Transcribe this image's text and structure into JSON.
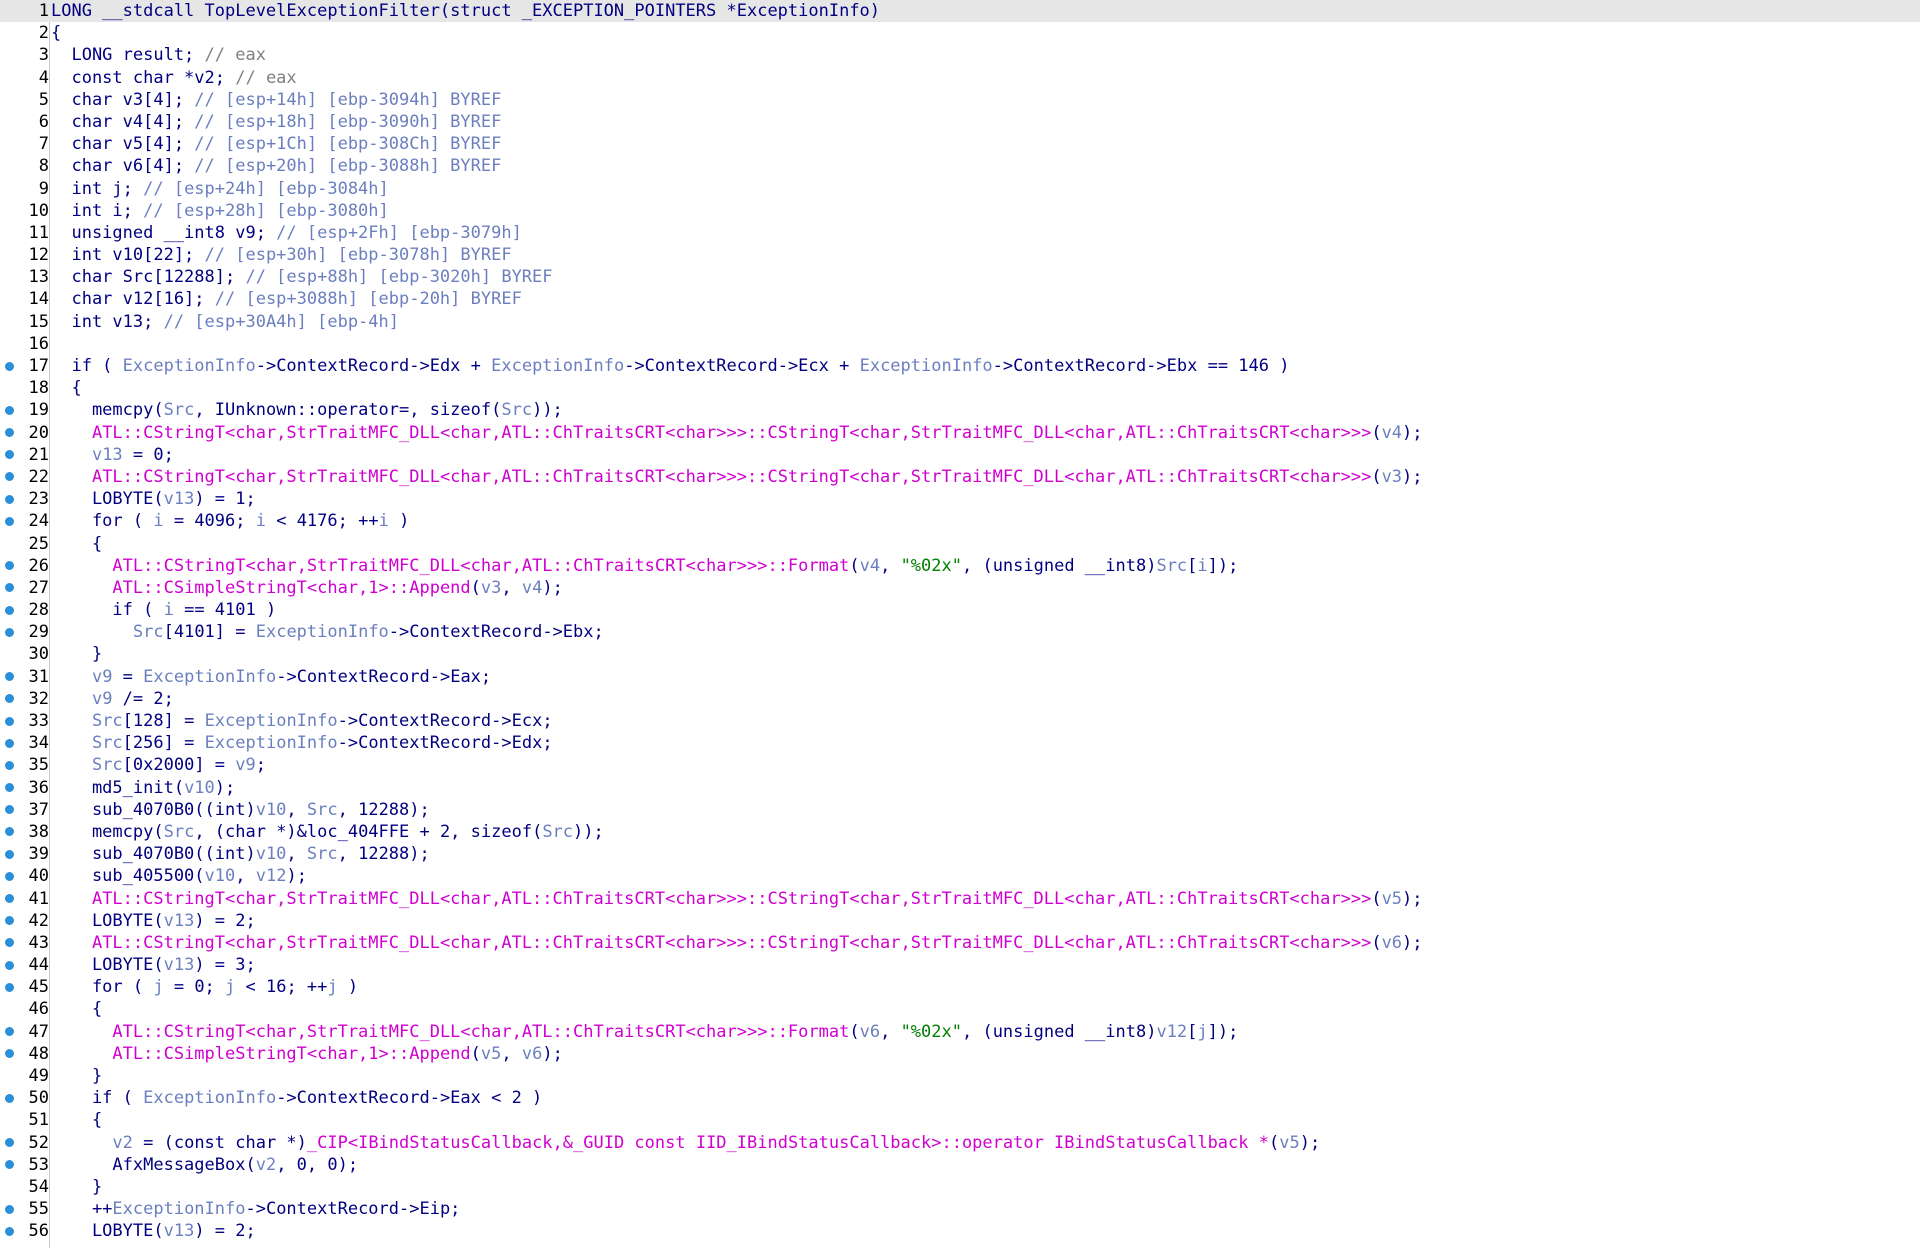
{
  "editor": {
    "lines": [
      {
        "n": "1",
        "dot": false,
        "hl": true,
        "t": [
          [
            "k",
            "LONG __stdcall TopLevelExceptionFilter(struct _EXCEPTION_POINTERS *ExceptionInfo)"
          ]
        ]
      },
      {
        "n": "2",
        "dot": false,
        "t": [
          [
            "k",
            "{"
          ]
        ]
      },
      {
        "n": "3",
        "dot": false,
        "t": [
          [
            "k",
            "  LONG result; "
          ],
          [
            "c",
            "// eax"
          ]
        ]
      },
      {
        "n": "4",
        "dot": false,
        "t": [
          [
            "k",
            "  const char *v2; "
          ],
          [
            "c",
            "// eax"
          ]
        ]
      },
      {
        "n": "5",
        "dot": false,
        "t": [
          [
            "k",
            "  char v3[4]; "
          ],
          [
            "v",
            "// [esp+14h] [ebp-3094h] BYREF"
          ]
        ]
      },
      {
        "n": "6",
        "dot": false,
        "t": [
          [
            "k",
            "  char v4[4]; "
          ],
          [
            "v",
            "// [esp+18h] [ebp-3090h] BYREF"
          ]
        ]
      },
      {
        "n": "7",
        "dot": false,
        "t": [
          [
            "k",
            "  char v5[4]; "
          ],
          [
            "v",
            "// [esp+1Ch] [ebp-308Ch] BYREF"
          ]
        ]
      },
      {
        "n": "8",
        "dot": false,
        "t": [
          [
            "k",
            "  char v6[4]; "
          ],
          [
            "v",
            "// [esp+20h] [ebp-3088h] BYREF"
          ]
        ]
      },
      {
        "n": "9",
        "dot": false,
        "t": [
          [
            "k",
            "  int j; "
          ],
          [
            "v",
            "// [esp+24h] [ebp-3084h]"
          ]
        ]
      },
      {
        "n": "10",
        "dot": false,
        "t": [
          [
            "k",
            "  int i; "
          ],
          [
            "v",
            "// [esp+28h] [ebp-3080h]"
          ]
        ]
      },
      {
        "n": "11",
        "dot": false,
        "t": [
          [
            "k",
            "  unsigned __int8 v9; "
          ],
          [
            "v",
            "// [esp+2Fh] [ebp-3079h]"
          ]
        ]
      },
      {
        "n": "12",
        "dot": false,
        "t": [
          [
            "k",
            "  int v10[22]; "
          ],
          [
            "v",
            "// [esp+30h] [ebp-3078h] BYREF"
          ]
        ]
      },
      {
        "n": "13",
        "dot": false,
        "t": [
          [
            "k",
            "  char Src[12288]; "
          ],
          [
            "v",
            "// [esp+88h] [ebp-3020h] BYREF"
          ]
        ]
      },
      {
        "n": "14",
        "dot": false,
        "t": [
          [
            "k",
            "  char v12[16]; "
          ],
          [
            "v",
            "// [esp+3088h] [ebp-20h] BYREF"
          ]
        ]
      },
      {
        "n": "15",
        "dot": false,
        "t": [
          [
            "k",
            "  int v13; "
          ],
          [
            "v",
            "// [esp+30A4h] [ebp-4h]"
          ]
        ]
      },
      {
        "n": "16",
        "dot": false,
        "t": [
          [
            "k",
            ""
          ]
        ]
      },
      {
        "n": "17",
        "dot": true,
        "t": [
          [
            "k",
            "  if ( "
          ],
          [
            "v",
            "ExceptionInfo"
          ],
          [
            "k",
            "->ContextRecord->Edx + "
          ],
          [
            "v",
            "ExceptionInfo"
          ],
          [
            "k",
            "->ContextRecord->Ecx + "
          ],
          [
            "v",
            "ExceptionInfo"
          ],
          [
            "k",
            "->ContextRecord->Ebx == 146 )"
          ]
        ]
      },
      {
        "n": "18",
        "dot": false,
        "t": [
          [
            "k",
            "  {"
          ]
        ]
      },
      {
        "n": "19",
        "dot": true,
        "t": [
          [
            "k",
            "    memcpy("
          ],
          [
            "v",
            "Src"
          ],
          [
            "k",
            ", IUnknown::operator=, sizeof("
          ],
          [
            "v",
            "Src"
          ],
          [
            "k",
            "));"
          ]
        ]
      },
      {
        "n": "20",
        "dot": true,
        "t": [
          [
            "k",
            "    "
          ],
          [
            "m",
            "ATL::CStringT<char,StrTraitMFC_DLL<char,ATL::ChTraitsCRT<char>>>::CStringT<char,StrTraitMFC_DLL<char,ATL::ChTraitsCRT<char>>>"
          ],
          [
            "k",
            "("
          ],
          [
            "v",
            "v4"
          ],
          [
            "k",
            ");"
          ]
        ]
      },
      {
        "n": "21",
        "dot": true,
        "t": [
          [
            "k",
            "    "
          ],
          [
            "v",
            "v13"
          ],
          [
            "k",
            " = 0;"
          ]
        ]
      },
      {
        "n": "22",
        "dot": true,
        "t": [
          [
            "k",
            "    "
          ],
          [
            "m",
            "ATL::CStringT<char,StrTraitMFC_DLL<char,ATL::ChTraitsCRT<char>>>::CStringT<char,StrTraitMFC_DLL<char,ATL::ChTraitsCRT<char>>>"
          ],
          [
            "k",
            "("
          ],
          [
            "v",
            "v3"
          ],
          [
            "k",
            ");"
          ]
        ]
      },
      {
        "n": "23",
        "dot": true,
        "t": [
          [
            "k",
            "    LOBYTE("
          ],
          [
            "v",
            "v13"
          ],
          [
            "k",
            ") = 1;"
          ]
        ]
      },
      {
        "n": "24",
        "dot": true,
        "t": [
          [
            "k",
            "    for ( "
          ],
          [
            "v",
            "i"
          ],
          [
            "k",
            " = 4096; "
          ],
          [
            "v",
            "i"
          ],
          [
            "k",
            " < 4176; ++"
          ],
          [
            "v",
            "i"
          ],
          [
            "k",
            " )"
          ]
        ]
      },
      {
        "n": "25",
        "dot": false,
        "t": [
          [
            "k",
            "    {"
          ]
        ]
      },
      {
        "n": "26",
        "dot": true,
        "t": [
          [
            "k",
            "      "
          ],
          [
            "m",
            "ATL::CStringT<char,StrTraitMFC_DLL<char,ATL::ChTraitsCRT<char>>>::Format"
          ],
          [
            "k",
            "("
          ],
          [
            "v",
            "v4"
          ],
          [
            "k",
            ", "
          ],
          [
            "s",
            "\"%02x\""
          ],
          [
            "k",
            ", (unsigned __int8)"
          ],
          [
            "v",
            "Src"
          ],
          [
            "k",
            "["
          ],
          [
            "v",
            "i"
          ],
          [
            "k",
            "]);"
          ]
        ]
      },
      {
        "n": "27",
        "dot": true,
        "t": [
          [
            "k",
            "      "
          ],
          [
            "m",
            "ATL::CSimpleStringT<char,1>::Append"
          ],
          [
            "k",
            "("
          ],
          [
            "v",
            "v3"
          ],
          [
            "k",
            ", "
          ],
          [
            "v",
            "v4"
          ],
          [
            "k",
            ");"
          ]
        ]
      },
      {
        "n": "28",
        "dot": true,
        "t": [
          [
            "k",
            "      if ( "
          ],
          [
            "v",
            "i"
          ],
          [
            "k",
            " == 4101 )"
          ]
        ]
      },
      {
        "n": "29",
        "dot": true,
        "t": [
          [
            "k",
            "        "
          ],
          [
            "v",
            "Src"
          ],
          [
            "k",
            "[4101] = "
          ],
          [
            "v",
            "ExceptionInfo"
          ],
          [
            "k",
            "->ContextRecord->Ebx;"
          ]
        ]
      },
      {
        "n": "30",
        "dot": false,
        "t": [
          [
            "k",
            "    }"
          ]
        ]
      },
      {
        "n": "31",
        "dot": true,
        "t": [
          [
            "k",
            "    "
          ],
          [
            "v",
            "v9"
          ],
          [
            "k",
            " = "
          ],
          [
            "v",
            "ExceptionInfo"
          ],
          [
            "k",
            "->ContextRecord->Eax;"
          ]
        ]
      },
      {
        "n": "32",
        "dot": true,
        "t": [
          [
            "k",
            "    "
          ],
          [
            "v",
            "v9"
          ],
          [
            "k",
            " /= 2;"
          ]
        ]
      },
      {
        "n": "33",
        "dot": true,
        "t": [
          [
            "k",
            "    "
          ],
          [
            "v",
            "Src"
          ],
          [
            "k",
            "[128] = "
          ],
          [
            "v",
            "ExceptionInfo"
          ],
          [
            "k",
            "->ContextRecord->Ecx;"
          ]
        ]
      },
      {
        "n": "34",
        "dot": true,
        "t": [
          [
            "k",
            "    "
          ],
          [
            "v",
            "Src"
          ],
          [
            "k",
            "[256] = "
          ],
          [
            "v",
            "ExceptionInfo"
          ],
          [
            "k",
            "->ContextRecord->Edx;"
          ]
        ]
      },
      {
        "n": "35",
        "dot": true,
        "t": [
          [
            "k",
            "    "
          ],
          [
            "v",
            "Src"
          ],
          [
            "k",
            "[0x2000] = "
          ],
          [
            "v",
            "v9"
          ],
          [
            "k",
            ";"
          ]
        ]
      },
      {
        "n": "36",
        "dot": true,
        "t": [
          [
            "k",
            "    md5_init("
          ],
          [
            "v",
            "v10"
          ],
          [
            "k",
            ");"
          ]
        ]
      },
      {
        "n": "37",
        "dot": true,
        "t": [
          [
            "k",
            "    sub_4070B0((int)"
          ],
          [
            "v",
            "v10"
          ],
          [
            "k",
            ", "
          ],
          [
            "v",
            "Src"
          ],
          [
            "k",
            ", 12288);"
          ]
        ]
      },
      {
        "n": "38",
        "dot": true,
        "t": [
          [
            "k",
            "    memcpy("
          ],
          [
            "v",
            "Src"
          ],
          [
            "k",
            ", (char *)&loc_404FFE + 2, sizeof("
          ],
          [
            "v",
            "Src"
          ],
          [
            "k",
            "));"
          ]
        ]
      },
      {
        "n": "39",
        "dot": true,
        "t": [
          [
            "k",
            "    sub_4070B0((int)"
          ],
          [
            "v",
            "v10"
          ],
          [
            "k",
            ", "
          ],
          [
            "v",
            "Src"
          ],
          [
            "k",
            ", 12288);"
          ]
        ]
      },
      {
        "n": "40",
        "dot": true,
        "t": [
          [
            "k",
            "    sub_405500("
          ],
          [
            "v",
            "v10"
          ],
          [
            "k",
            ", "
          ],
          [
            "v",
            "v12"
          ],
          [
            "k",
            ");"
          ]
        ]
      },
      {
        "n": "41",
        "dot": true,
        "t": [
          [
            "k",
            "    "
          ],
          [
            "m",
            "ATL::CStringT<char,StrTraitMFC_DLL<char,ATL::ChTraitsCRT<char>>>::CStringT<char,StrTraitMFC_DLL<char,ATL::ChTraitsCRT<char>>>"
          ],
          [
            "k",
            "("
          ],
          [
            "v",
            "v5"
          ],
          [
            "k",
            ");"
          ]
        ]
      },
      {
        "n": "42",
        "dot": true,
        "t": [
          [
            "k",
            "    LOBYTE("
          ],
          [
            "v",
            "v13"
          ],
          [
            "k",
            ") = 2;"
          ]
        ]
      },
      {
        "n": "43",
        "dot": true,
        "t": [
          [
            "k",
            "    "
          ],
          [
            "m",
            "ATL::CStringT<char,StrTraitMFC_DLL<char,ATL::ChTraitsCRT<char>>>::CStringT<char,StrTraitMFC_DLL<char,ATL::ChTraitsCRT<char>>>"
          ],
          [
            "k",
            "("
          ],
          [
            "v",
            "v6"
          ],
          [
            "k",
            ");"
          ]
        ]
      },
      {
        "n": "44",
        "dot": true,
        "t": [
          [
            "k",
            "    LOBYTE("
          ],
          [
            "v",
            "v13"
          ],
          [
            "k",
            ") = 3;"
          ]
        ]
      },
      {
        "n": "45",
        "dot": true,
        "t": [
          [
            "k",
            "    for ( "
          ],
          [
            "v",
            "j"
          ],
          [
            "k",
            " = 0; "
          ],
          [
            "v",
            "j"
          ],
          [
            "k",
            " < 16; ++"
          ],
          [
            "v",
            "j"
          ],
          [
            "k",
            " )"
          ]
        ]
      },
      {
        "n": "46",
        "dot": false,
        "t": [
          [
            "k",
            "    {"
          ]
        ]
      },
      {
        "n": "47",
        "dot": true,
        "t": [
          [
            "k",
            "      "
          ],
          [
            "m",
            "ATL::CStringT<char,StrTraitMFC_DLL<char,ATL::ChTraitsCRT<char>>>::Format"
          ],
          [
            "k",
            "("
          ],
          [
            "v",
            "v6"
          ],
          [
            "k",
            ", "
          ],
          [
            "s",
            "\"%02x\""
          ],
          [
            "k",
            ", (unsigned __int8)"
          ],
          [
            "v",
            "v12"
          ],
          [
            "k",
            "["
          ],
          [
            "v",
            "j"
          ],
          [
            "k",
            "]);"
          ]
        ]
      },
      {
        "n": "48",
        "dot": true,
        "t": [
          [
            "k",
            "      "
          ],
          [
            "m",
            "ATL::CSimpleStringT<char,1>::Append"
          ],
          [
            "k",
            "("
          ],
          [
            "v",
            "v5"
          ],
          [
            "k",
            ", "
          ],
          [
            "v",
            "v6"
          ],
          [
            "k",
            ");"
          ]
        ]
      },
      {
        "n": "49",
        "dot": false,
        "t": [
          [
            "k",
            "    }"
          ]
        ]
      },
      {
        "n": "50",
        "dot": true,
        "t": [
          [
            "k",
            "    if ( "
          ],
          [
            "v",
            "ExceptionInfo"
          ],
          [
            "k",
            "->ContextRecord->Eax < 2 )"
          ]
        ]
      },
      {
        "n": "51",
        "dot": false,
        "t": [
          [
            "k",
            "    {"
          ]
        ]
      },
      {
        "n": "52",
        "dot": true,
        "t": [
          [
            "k",
            "      "
          ],
          [
            "v",
            "v2"
          ],
          [
            "k",
            " = (const char *)"
          ],
          [
            "m",
            "_CIP<IBindStatusCallback,&_GUID const IID_IBindStatusCallback>::operator IBindStatusCallback *"
          ],
          [
            "k",
            "("
          ],
          [
            "v",
            "v5"
          ],
          [
            "k",
            ");"
          ]
        ]
      },
      {
        "n": "53",
        "dot": true,
        "t": [
          [
            "k",
            "      AfxMessageBox("
          ],
          [
            "v",
            "v2"
          ],
          [
            "k",
            ", 0, 0);"
          ]
        ]
      },
      {
        "n": "54",
        "dot": false,
        "t": [
          [
            "k",
            "    }"
          ]
        ]
      },
      {
        "n": "55",
        "dot": true,
        "t": [
          [
            "k",
            "    ++"
          ],
          [
            "v",
            "ExceptionInfo"
          ],
          [
            "k",
            "->ContextRecord->Eip;"
          ]
        ]
      },
      {
        "n": "56",
        "dot": true,
        "t": [
          [
            "k",
            "    LOBYTE("
          ],
          [
            "v",
            "v13"
          ],
          [
            "k",
            ") = 2;"
          ]
        ]
      }
    ]
  },
  "colors": {
    "background": "#ffffff",
    "code": "#000080",
    "local_var": "#6b7fbf",
    "library_func": "#d000d0",
    "string": "#008000",
    "comment": "#808080",
    "breakpoint_dot": "#2a8fd6"
  }
}
